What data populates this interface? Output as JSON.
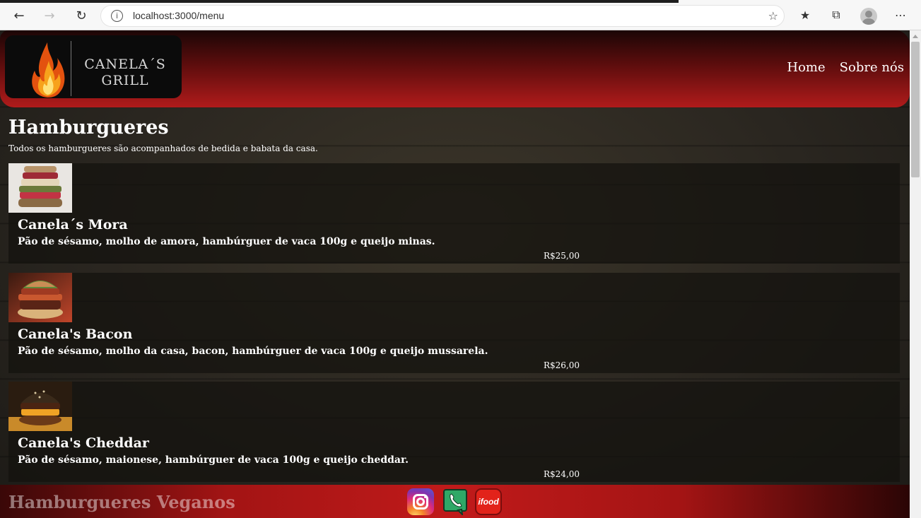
{
  "browser": {
    "url": "localhost:3000/menu",
    "back_icon": "←",
    "forward_icon": "→",
    "refresh_icon": "↻",
    "info_icon": "i",
    "add_favorite_icon": "☆",
    "favorites_icon": "★",
    "collections_icon": "⧉",
    "more_icon": "⋯"
  },
  "header": {
    "logo_text": "CANELA´S GRILL",
    "nav": [
      "Home",
      "Sobre nós"
    ]
  },
  "section": {
    "title": "Hamburgueres",
    "subtitle": "Todos os hamburgueres são acompanhados de bedida e babata da casa."
  },
  "items": [
    {
      "name": "Canela´s Mora",
      "description": "Pão de sésamo, molho de amora, hambúrguer de vaca 100g e queijo minas.",
      "price": "R$25,00"
    },
    {
      "name": "Canela's Bacon",
      "description": "Pão de sésamo, molho da casa, bacon, hambúrguer de vaca 100g e queijo mussarela.",
      "price": "R$26,00"
    },
    {
      "name": "Canela's Cheddar",
      "description": "Pão de sésamo, maionese, hambúrguer de vaca 100g e queijo cheddar.",
      "price": "R$24,00"
    }
  ],
  "next_section": {
    "title": "Hamburgueres Veganos"
  },
  "footer": {
    "ifood_label": "ifood"
  },
  "colors": {
    "header_red": "#b01b1b",
    "header_dark": "#1b0606",
    "footer_red": "#c01a1a",
    "text": "#ffffff"
  }
}
